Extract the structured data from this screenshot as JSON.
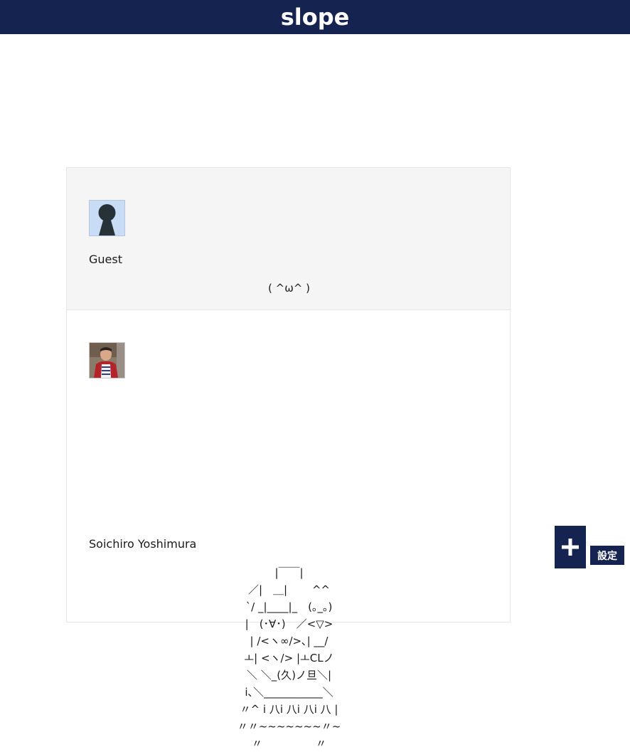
{
  "header": {
    "logo": "slope",
    "background": "#142350"
  },
  "posts": [
    {
      "author": "Guest",
      "avatar_icon": "guest-silhouette-icon",
      "text": "( ^ω^ )"
    },
    {
      "author": "Soichiro Yoshimura",
      "avatar_icon": "user-photo-avatar",
      "art_lines": [
        "|￣￣|",
        "／|　＿|　　 ^^",
        "`/ _|____|_　(｡_｡)",
        "|　(･∀･)　／<▽>",
        "| /<ヽ∞/>､| __/",
        "ㅗ| <ヽ/> |ㅗCLノ",
        "＼ ＼_(久)ノ旦＼|",
        "i､＼___________＼",
        "〃^ i 八i 八i 八i 八 |",
        "〃〃~~~~~~~〃~",
        "〃　　　　　〃"
      ]
    }
  ],
  "fab": {
    "icon": "plus-icon"
  },
  "settings": {
    "label": "設定"
  }
}
